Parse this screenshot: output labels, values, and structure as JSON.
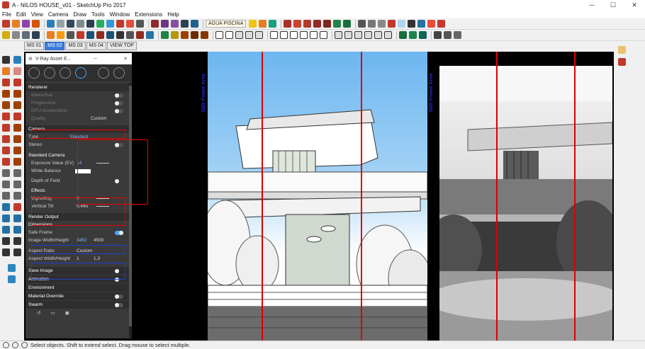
{
  "window": {
    "title": "A - NILOS HOUSE_v01 - SketchUp Pro 2017",
    "controls": [
      "minimize",
      "maximize",
      "close"
    ]
  },
  "menu": [
    "File",
    "Edit",
    "View",
    "Camera",
    "Draw",
    "Tools",
    "Window",
    "Extensions",
    "Help"
  ],
  "toolbar": {
    "layer_dropdown": "AGUA PISCINA"
  },
  "scene_tabs": [
    {
      "label": "MS 01",
      "active": false
    },
    {
      "label": "MS 02",
      "active": true
    },
    {
      "label": "MS 03",
      "active": false
    },
    {
      "label": "MS 04",
      "active": false
    },
    {
      "label": "VIEW TOP",
      "active": false
    }
  ],
  "vray": {
    "title": "V-Ray Asset E...",
    "sections": {
      "renderer": "Renderer",
      "interactive": "Interactive",
      "progressive": "Progressive",
      "gpu": "GPU Acceleration",
      "quality": "Quality",
      "quality_value": "Custom",
      "camera": "Camera",
      "type": "Type",
      "type_value": "Standard",
      "stereo": "Stereo",
      "standard_camera": "Standard Camera",
      "exposure": "Exposure Value (EV)",
      "exposure_value": "14",
      "white_balance": "White Balance",
      "dof": "Depth of Field",
      "effects": "Effects",
      "vignetting": "Vignetting",
      "vignetting_value": "0",
      "vertical_tilt": "Vertical Tilt",
      "vertical_tilt_value": "0,445",
      "render_output": "Render Output",
      "dimensions": "Dimensions",
      "safe_frame": "Safe Frame",
      "image_wh": "Image Width/Height",
      "image_w": "3462",
      "image_h": "4500",
      "aspect_ratio": "Aspect Ratio",
      "aspect_ratio_value": "Custom",
      "aspect_wh": "Aspect Width/Height",
      "aspect_w": "1",
      "aspect_h": "1,3",
      "save_image": "Save Image",
      "animation": "Animation",
      "environment": "Environment",
      "material_override": "Material Override",
      "swarm": "Swarm"
    }
  },
  "viewport": {
    "safe_frame_label": "Safe Frame Area"
  },
  "status": {
    "message": "Select objects. Shift to extend select. Drag mouse to select multiple."
  },
  "colors": {
    "accent": "#3b7ddd",
    "highlight_red": "#e00000",
    "highlight_blue": "#1d3fd0",
    "sky": "#6db6f0"
  }
}
